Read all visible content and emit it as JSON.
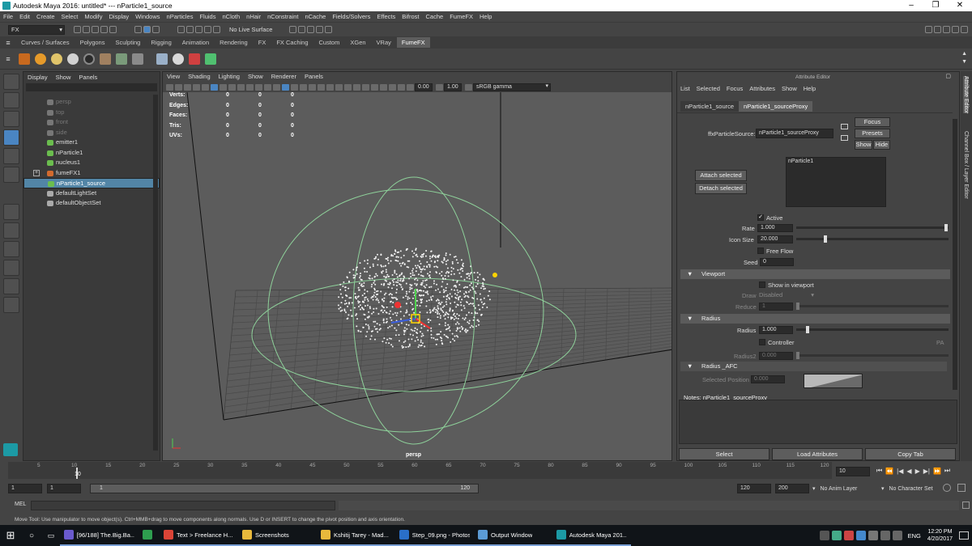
{
  "window": {
    "title": "Autodesk Maya 2016: untitled*   ---   nParticle1_source",
    "controls": [
      "–",
      "❐",
      "✕"
    ]
  },
  "menubar": [
    "File",
    "Edit",
    "Create",
    "Select",
    "Modify",
    "Display",
    "Windows",
    "nParticles",
    "Fluids",
    "nCloth",
    "nHair",
    "nConstraint",
    "nCache",
    "Fields/Solvers",
    "Effects",
    "Bifrost",
    "Cache",
    "FumeFX",
    "Help"
  ],
  "statusline": {
    "menuset": "FX",
    "live_surface": "No Live Surface"
  },
  "shelf_tabs": [
    "Curves / Surfaces",
    "Polygons",
    "Sculpting",
    "Rigging",
    "Animation",
    "Rendering",
    "FX",
    "FX Caching",
    "Custom",
    "XGen",
    "VRay",
    "FumeFX"
  ],
  "shelf_active": "FumeFX",
  "outliner": {
    "menu": [
      "Display",
      "Show",
      "Panels"
    ],
    "items": [
      {
        "label": "persp",
        "dim": true,
        "color": "#777"
      },
      {
        "label": "top",
        "dim": true,
        "color": "#777"
      },
      {
        "label": "front",
        "dim": true,
        "color": "#777"
      },
      {
        "label": "side",
        "dim": true,
        "color": "#777"
      },
      {
        "label": "emitter1",
        "dim": false,
        "color": "#6bbd4e"
      },
      {
        "label": "nParticle1",
        "dim": false,
        "color": "#6bbd4e"
      },
      {
        "label": "nucleus1",
        "dim": false,
        "color": "#6bbd4e"
      },
      {
        "label": "fumeFX1",
        "dim": false,
        "color": "#d26a2e",
        "expand": "+"
      },
      {
        "label": "nParticle1_source",
        "dim": false,
        "color": "#6bbd4e",
        "selected": true
      },
      {
        "label": "defaultLightSet",
        "dim": false,
        "color": "#aaa"
      },
      {
        "label": "defaultObjectSet",
        "dim": false,
        "color": "#aaa"
      }
    ]
  },
  "viewport": {
    "menu": [
      "View",
      "Shading",
      "Lighting",
      "Show",
      "Renderer",
      "Panels"
    ],
    "exposure": "0.00",
    "gamma": "1.00",
    "color_space": "sRGB gamma",
    "camera_label": "persp",
    "hud": [
      {
        "label": "Verts:",
        "v": [
          "0",
          "0",
          "0"
        ]
      },
      {
        "label": "Edges:",
        "v": [
          "0",
          "0",
          "0"
        ]
      },
      {
        "label": "Faces:",
        "v": [
          "0",
          "0",
          "0"
        ]
      },
      {
        "label": "Tris:",
        "v": [
          "0",
          "0",
          "0"
        ]
      },
      {
        "label": "UVs:",
        "v": [
          "0",
          "0",
          "0"
        ]
      }
    ]
  },
  "attribute_editor": {
    "title": "Attribute Editor",
    "menu": [
      "List",
      "Selected",
      "Focus",
      "Attributes",
      "Show",
      "Help"
    ],
    "tabs": [
      "nParticle1_source",
      "nParticle1_sourceProxy"
    ],
    "active_tab": "nParticle1_sourceProxy",
    "source_label": "ffxParticleSource:",
    "source_value": "nParticle1_sourceProxy",
    "focus": "Focus",
    "presets": "Presets",
    "show": "Show",
    "hide": "Hide",
    "list_item": "nParticle1",
    "attach": "Attach selected",
    "detach": "Detach selected",
    "active_label": "Active",
    "rate_label": "Rate",
    "rate_value": "1.000",
    "icon_size_label": "Icon Size",
    "icon_size_value": "20.000",
    "free_flow": "Free Flow",
    "seed_label": "Seed",
    "seed_value": "0",
    "sec_viewport": "Viewport",
    "show_in_viewport": "Show in viewport",
    "draw_label": "Draw",
    "draw_value": "Disabled",
    "reduce_label": "Reduce",
    "reduce_value": "1",
    "sec_radius": "Radius",
    "radius_label": "Radius",
    "radius_value": "1.000",
    "controller": "Controller",
    "pa": "PA",
    "radius2_label": "Radius2",
    "radius2_value": "0.000",
    "sec_radius_afc": "Radius _AFC",
    "selected_position_label": "Selected Position",
    "selected_position_value": "0.000",
    "notes": "Notes:  nParticle1_sourceProxy",
    "bottom_buttons": [
      "Select",
      "Load Attributes",
      "Copy Tab"
    ]
  },
  "side_tabs": [
    "Attribute Editor",
    "Channel Box / Layer Editor"
  ],
  "timeline": {
    "ticks": [
      "5",
      "10",
      "15",
      "20",
      "25",
      "30",
      "35",
      "40",
      "45",
      "50",
      "55",
      "60",
      "65",
      "70",
      "75",
      "80",
      "85",
      "90",
      "95",
      "100",
      "105",
      "110",
      "115",
      "120"
    ],
    "current_frame": "10",
    "current_tick": "10",
    "range_start": "1",
    "playback_start": "1",
    "slider_start": "1",
    "slider_end": "120",
    "range_end": "120",
    "anim_end": "200",
    "anim_layer": "No Anim Layer",
    "character_set": "No Character Set"
  },
  "mel_label": "MEL",
  "help_line": "Move Tool: Use manipulator to move object(s). Ctrl+MMB+drag to move components along normals. Use D or INSERT to change the pivot position and axis orientation.",
  "taskbar": {
    "items": [
      {
        "label": "[96/188] The.Big.Ba...",
        "color": "#6a5acd"
      },
      {
        "label": "",
        "color": "#2e9e4f"
      },
      {
        "label": "Text > Freelance H...",
        "color": "#db4437"
      },
      {
        "label": "Screenshots",
        "color": "#e8b93c"
      },
      {
        "label": "Kshitij Tarey - Mad...",
        "color": "#e8b93c"
      },
      {
        "label": "Step_09.png - Photos",
        "color": "#2a6fc9"
      },
      {
        "label": "Output Window",
        "color": "#5b9bd5"
      },
      {
        "label": "Autodesk Maya 201...",
        "color": "#1c9aa5"
      }
    ],
    "lang": "ENG",
    "time": "12:20 PM",
    "date": "4/20/2017"
  }
}
